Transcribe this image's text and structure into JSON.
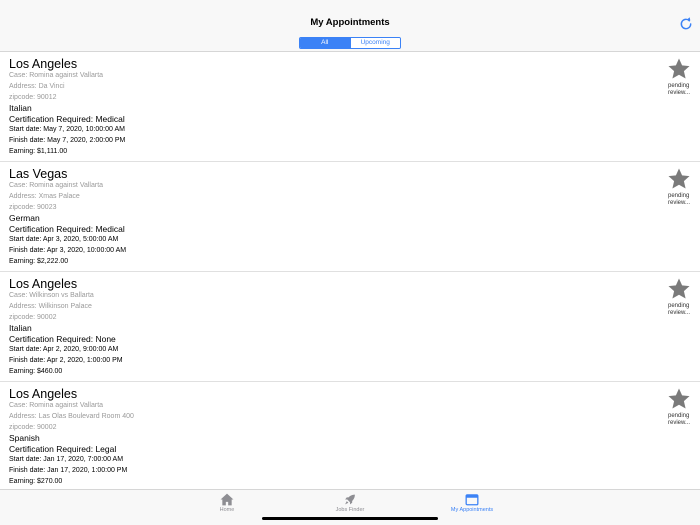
{
  "header": {
    "title": "My Appointments",
    "segments": [
      "All",
      "Upcoming"
    ],
    "selected_segment": "All",
    "refresh_icon": "refresh-icon"
  },
  "appointments": [
    {
      "city": "Los Angeles",
      "case": "Case: Romina against Vallarta",
      "address": "Address: Da Vinci",
      "zipcode": "zipcode: 90012",
      "language": "Italian",
      "certification": "Certification Required: Medical",
      "start": "Start date: May 7, 2020, 10:00:00 AM",
      "finish": "Finish date: May 7, 2020, 2:00:00 PM",
      "earning": "Earning: $1,111.00",
      "status": "pending review..."
    },
    {
      "city": "Las Vegas",
      "case": "Case: Romina against Vallarta",
      "address": "Address: Xmas Palace",
      "zipcode": "zipcode: 90023",
      "language": "German",
      "certification": "Certification Required: Medical",
      "start": "Start date: Apr 3, 2020, 5:00:00 AM",
      "finish": "Finish date: Apr 3, 2020, 10:00:00 AM",
      "earning": "Earning: $2,222.00",
      "status": "pending review..."
    },
    {
      "city": "Los Angeles",
      "case": "Case: Wilkinson vs Ballarta",
      "address": "Address: Wilkinson Palace",
      "zipcode": "zipcode: 90002",
      "language": "Italian",
      "certification": "Certification Required: None",
      "start": "Start date: Apr 2, 2020, 9:00:00 AM",
      "finish": "Finish date: Apr 2, 2020, 1:00:00 PM",
      "earning": "Earning: $460.00",
      "status": "pending review..."
    },
    {
      "city": "Los Angeles",
      "case": "Case: Romina against Vallarta",
      "address": "Address: Las Olas Boulevard Room 400",
      "zipcode": "zipcode: 90002",
      "language": "Spanish",
      "certification": "Certification Required: Legal",
      "start": "Start date: Jan 17, 2020, 7:00:00 AM",
      "finish": "Finish date: Jan 17, 2020, 1:00:00 PM",
      "earning": "Earning: $270.00",
      "status": "pending review..."
    }
  ],
  "tabbar": {
    "items": [
      {
        "label": "Home",
        "icon": "house-icon"
      },
      {
        "label": "Jobs Finder",
        "icon": "rocket-icon"
      },
      {
        "label": "My Appointments",
        "icon": "calendar-icon"
      }
    ],
    "active": "My Appointments"
  },
  "colors": {
    "accent": "#3b82f6",
    "star": "#7a7a7a",
    "secondary_text": "#9a9a9a"
  }
}
